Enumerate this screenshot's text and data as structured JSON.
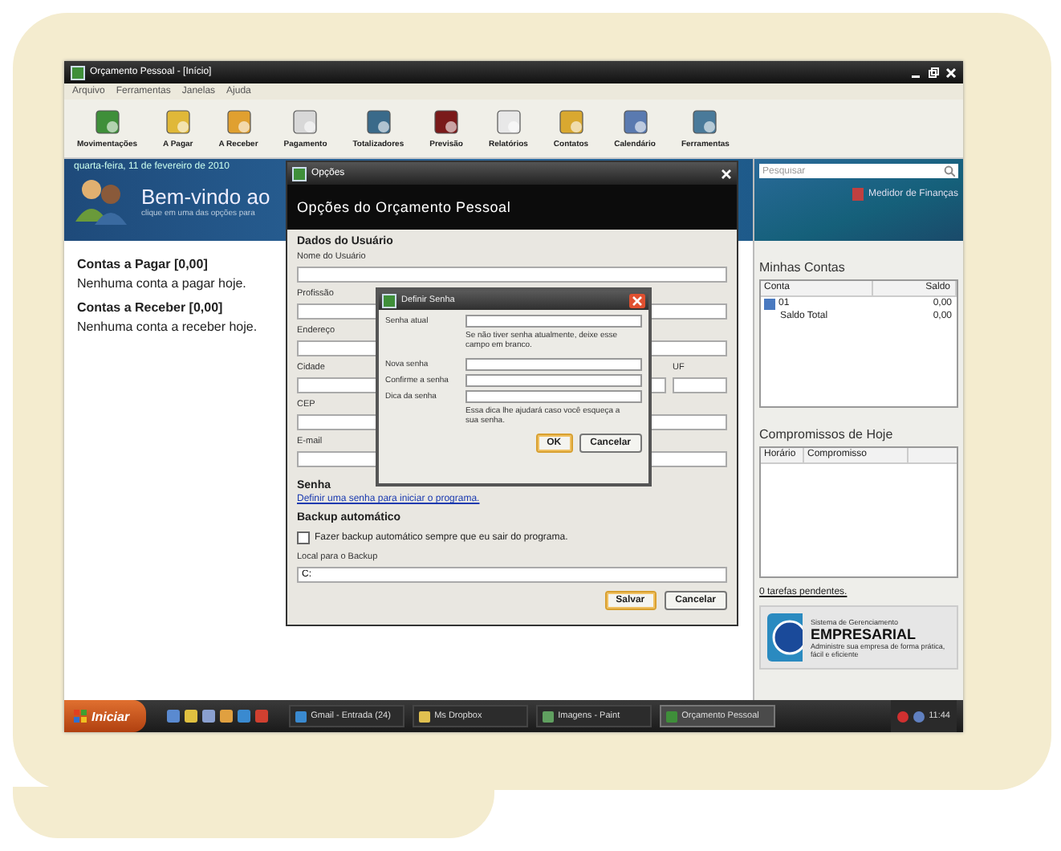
{
  "window": {
    "title": "Orçamento Pessoal - [Início]"
  },
  "menu": [
    "Arquivo",
    "Ferramentas",
    "Janelas",
    "Ajuda"
  ],
  "toolbar": [
    "Movimentações",
    "A Pagar",
    "A Receber",
    "Pagamento",
    "Totalizadores",
    "Previsão",
    "Relatórios",
    "Contatos",
    "Calendário",
    "Ferramentas"
  ],
  "banner": {
    "date": "quarta-feira, 11 de fevereiro de 2010",
    "title": "Bem-vindo ao",
    "subtitle": "clique em uma das opções para"
  },
  "summary": [
    {
      "heading": "Contas a Pagar [0,00]",
      "text": "Nenhuma conta a pagar hoje."
    },
    {
      "heading": "Contas a Receber [0,00]",
      "text": "Nenhuma conta a receber hoje."
    }
  ],
  "search": {
    "placeholder": "Pesquisar"
  },
  "finance_link": "Medidor de Finanças",
  "accounts": {
    "title": "Minhas Contas",
    "columns": [
      "Conta",
      "Saldo"
    ],
    "rows": [
      [
        "01",
        "0,00"
      ],
      [
        "Saldo Total",
        "0,00"
      ]
    ]
  },
  "appointments": {
    "title": "Compromissos de Hoje",
    "columns": [
      "Horário",
      "Compromisso"
    ]
  },
  "pending": "0 tarefas pendentes.",
  "ad": {
    "small": "Sistema de Gerenciamento",
    "title": "EMPRESARIAL",
    "text": "Administre sua empresa de forma prática, fácil e eficiente"
  },
  "options_dialog": {
    "title": "Opções",
    "header": "Opções do Orçamento Pessoal",
    "section": "Dados do Usuário",
    "fields": [
      {
        "label": "Nome do Usuário"
      },
      {
        "label": "Profissão"
      },
      {
        "label": "Endereço"
      },
      {
        "label": "Cidade",
        "side_label": "UF"
      },
      {
        "label": "CEP"
      },
      {
        "label": "E-mail"
      }
    ],
    "password_heading": "Senha",
    "password_link": "Definir uma senha para iniciar o programa.",
    "backup_heading": "Backup automático",
    "backup_check": {
      "label": "Fazer backup automático sempre que eu sair do programa.",
      "checked": false
    },
    "backup_location": {
      "label": "Local para o Backup",
      "value": "C:"
    },
    "buttons": [
      "Salvar",
      "Cancelar"
    ]
  },
  "password_dialog": {
    "title": "Definir Senha",
    "current_label": "Senha atual",
    "current_hint": "Se não tiver senha atualmente, deixe esse campo em branco.",
    "fields": [
      "Nova senha",
      "Confirme a senha",
      "Dica da senha"
    ],
    "hint": "Essa dica lhe ajudará caso você esqueça a sua senha.",
    "buttons": [
      "OK",
      "Cancelar"
    ]
  },
  "taskbar": {
    "start": "Iniciar",
    "tasks": [
      {
        "label": "Gmail - Entrada (24)",
        "selected": false
      },
      {
        "label": "Ms Dropbox",
        "selected": false
      },
      {
        "label": "Imagens - Paint",
        "selected": false
      },
      {
        "label": "Orçamento Pessoal",
        "selected": true
      }
    ],
    "clock": "11:44"
  }
}
